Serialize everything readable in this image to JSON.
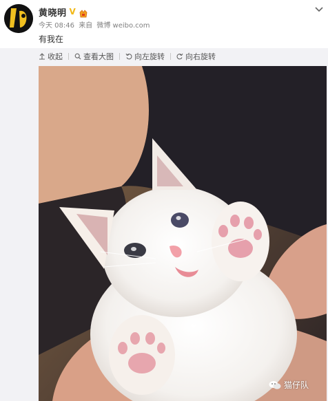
{
  "post": {
    "username": "黄晓明",
    "verified_mark": "V",
    "time": "今天 08:46",
    "source_prefix": "来自",
    "source": "微博 weibo.com",
    "text": "有我在"
  },
  "toolbar": {
    "collapse_label": "收起",
    "view_large_label": "查看大图",
    "rotate_left_label": "向左旋转",
    "rotate_right_label": "向右旋转"
  },
  "photo": {
    "watermark": "猫仔队"
  },
  "icons": {
    "menu": "chevron-down-icon",
    "collapse": "arrow-up-icon",
    "view_large": "search-icon",
    "rotate_left": "rotate-left-icon",
    "rotate_right": "rotate-right-icon",
    "watermark": "wechat-icon"
  },
  "colors": {
    "verified": "#f1b816",
    "text": "#333333",
    "meta": "#808080",
    "toolbar_bg": "#f2f2f5"
  }
}
